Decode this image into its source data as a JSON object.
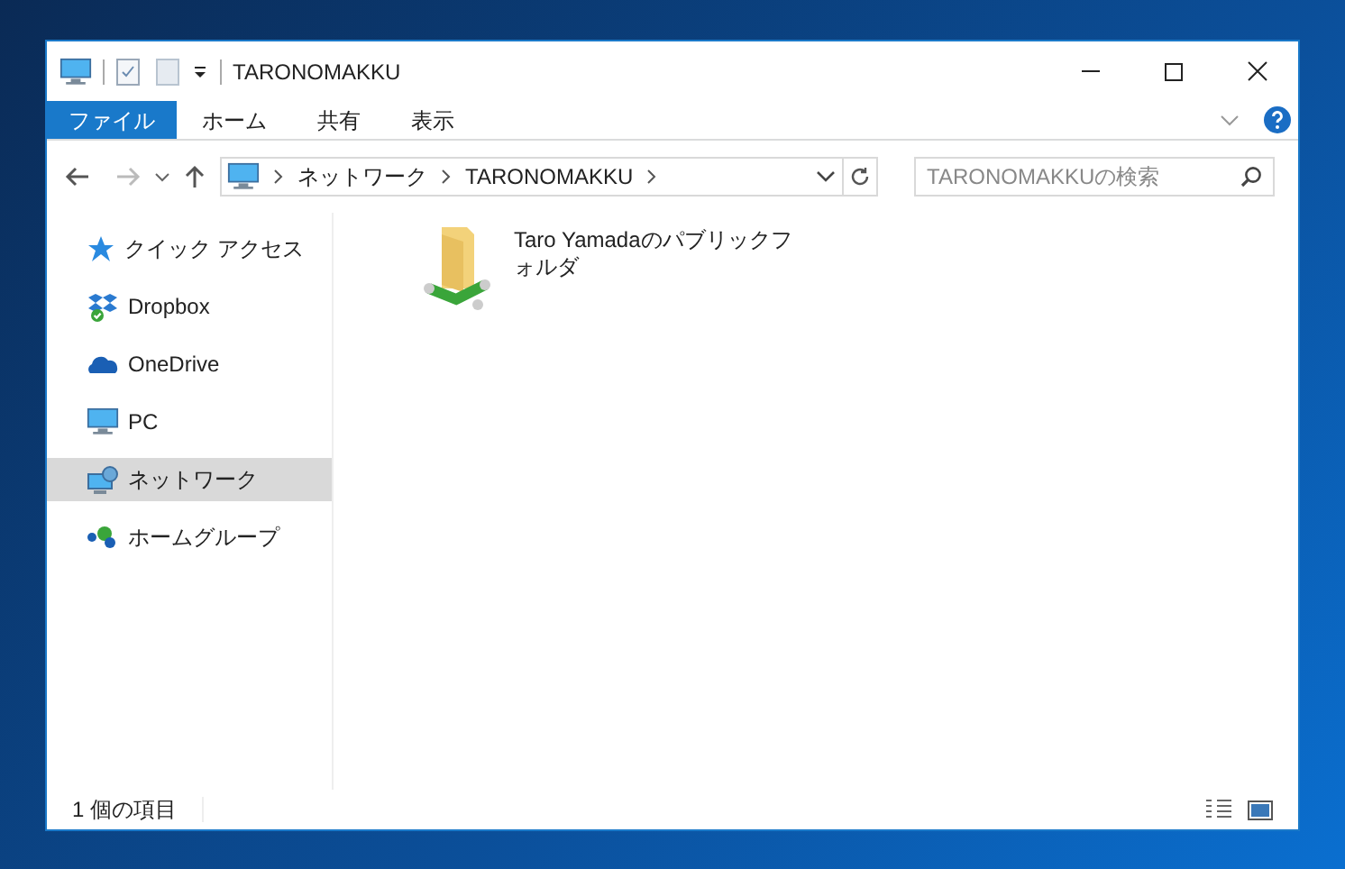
{
  "window": {
    "title": "TARONOMAKKU"
  },
  "ribbon_tabs": [
    {
      "label": "ファイル",
      "kind": "file"
    },
    {
      "label": "ホーム",
      "kind": "tab"
    },
    {
      "label": "共有",
      "kind": "tab"
    },
    {
      "label": "表示",
      "kind": "tab"
    }
  ],
  "address_bar": {
    "breadcrumbs": [
      "ネットワーク",
      "TARONOMAKKU"
    ]
  },
  "search": {
    "placeholder": "TARONOMAKKUの検索"
  },
  "sidebar": {
    "items": [
      {
        "label": "クイック アクセス",
        "kind": "star",
        "selected": false
      },
      {
        "label": "Dropbox",
        "kind": "dropbox",
        "selected": false
      },
      {
        "label": "OneDrive",
        "kind": "cloud",
        "selected": false
      },
      {
        "label": "PC",
        "kind": "pc",
        "selected": false
      },
      {
        "label": "ネットワーク",
        "kind": "network",
        "selected": true
      },
      {
        "label": "ホームグループ",
        "kind": "homegroup",
        "selected": false
      }
    ]
  },
  "items": [
    {
      "name": "Taro Yamadaのパブリックフォルダ"
    }
  ],
  "status_bar": {
    "count": "1 個の項目"
  }
}
